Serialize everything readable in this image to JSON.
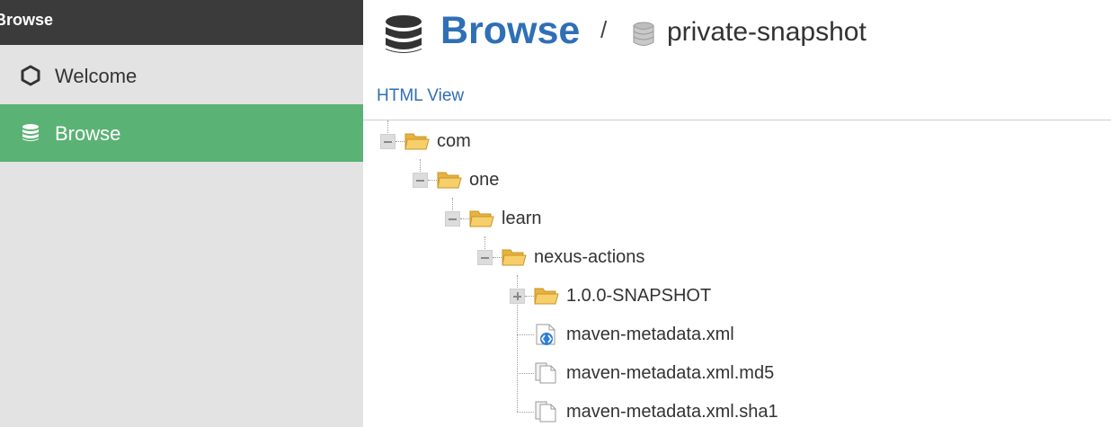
{
  "sidebar": {
    "header_title": "Browse",
    "items": [
      {
        "label": "Welcome",
        "icon": "hexagon-icon",
        "active": false
      },
      {
        "label": "Browse",
        "icon": "database-icon",
        "active": true
      }
    ]
  },
  "header": {
    "title": "Browse",
    "separator": "/",
    "repository": "private-snapshot"
  },
  "html_view_link": "HTML View",
  "tree": [
    {
      "label": "com",
      "type": "folder",
      "expanded": true
    },
    {
      "label": "one",
      "type": "folder",
      "expanded": true
    },
    {
      "label": "learn",
      "type": "folder",
      "expanded": true
    },
    {
      "label": "nexus-actions",
      "type": "folder",
      "expanded": true
    },
    {
      "label": "1.0.0-SNAPSHOT",
      "type": "folder",
      "expanded": false
    },
    {
      "label": "maven-metadata.xml",
      "type": "xml-file"
    },
    {
      "label": "maven-metadata.xml.md5",
      "type": "file"
    },
    {
      "label": "maven-metadata.xml.sha1",
      "type": "file"
    }
  ],
  "colors": {
    "sidebar_header": "#3b3b3b",
    "sidebar_bg": "#e3e3e3",
    "active_item": "#5bb275",
    "link": "#2f6fb6",
    "folder": "#f2c04f"
  }
}
